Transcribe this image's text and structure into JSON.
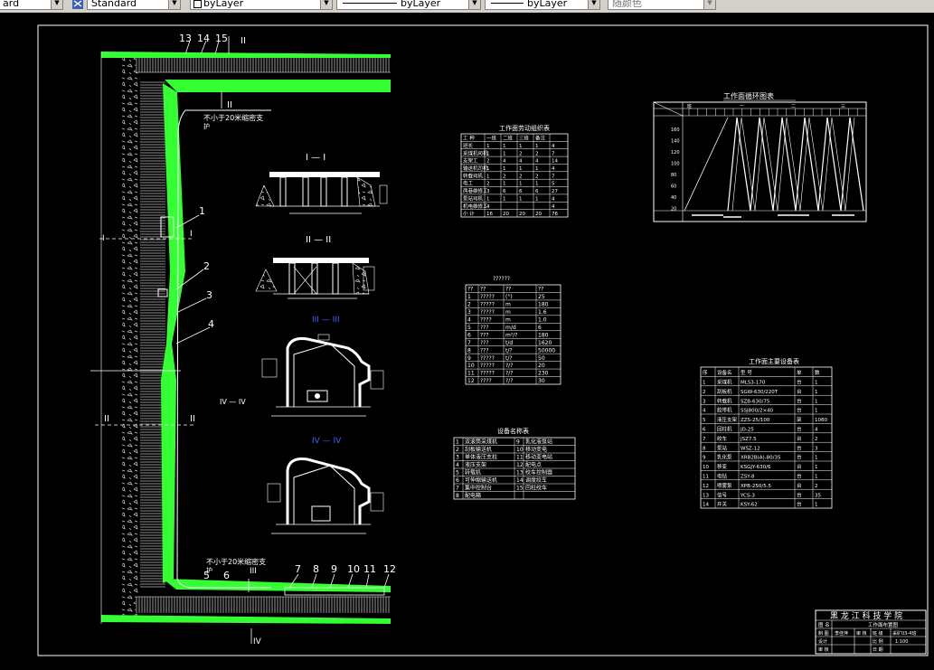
{
  "toolbar": {
    "text_style": "ard",
    "dim_style": "Standard",
    "layer": "byLayer",
    "linetype": "byLayer",
    "lineweight": "byLayer",
    "plot_style": "随颜色"
  },
  "drawing": {
    "labels": {
      "n13": "13",
      "n14": "14",
      "n15": "15",
      "sec2_top": "II",
      "sec2_mid": "II",
      "min20_top": "不小于20米缩密支",
      "min20_top2": "护",
      "n1": "1",
      "n2": "2",
      "n3": "3",
      "n4": "4",
      "sec1_left": "I",
      "sec1_right": "I",
      "sec2_left": "II",
      "sec2_right": "II",
      "min20_bot": "不小于20米缩密支",
      "min20_bot2": "护",
      "n5": "5",
      "n6": "6",
      "n7": "7",
      "n8": "8",
      "n9": "9",
      "n10": "10",
      "n11": "11",
      "n12": "12",
      "sec3": "III",
      "sec4": "IV",
      "secI_title": "I — I",
      "secII_title": "II — II",
      "secIII_title": "III — III",
      "secIV_title": "IV — IV",
      "secIII_blue": "III — III",
      "secIV_blue": "IV — IV"
    },
    "table_workers": {
      "title": "工作面劳动组织表",
      "headers": [
        "工 种",
        "一班",
        "二班",
        "三班",
        "备注"
      ],
      "rows": [
        [
          "班长",
          "1",
          "1",
          "1",
          "1",
          "4"
        ],
        [
          "采煤机司机",
          "1",
          "1",
          "2",
          "2",
          "7"
        ],
        [
          "支架工",
          "2",
          "4",
          "4",
          "4",
          "14"
        ],
        [
          "输送机司机",
          "1",
          "1",
          "1",
          "1",
          "4"
        ],
        [
          "转载司机",
          "1",
          "2",
          "2",
          "2",
          "7"
        ],
        [
          "电工",
          "2",
          "1",
          "1",
          "1",
          "5"
        ],
        [
          "两巷维修工",
          "3",
          "6",
          "6",
          "6",
          "27"
        ],
        [
          "泵站司机",
          "1",
          "1",
          "1",
          "1",
          "4"
        ],
        [
          "机电维修工",
          "4",
          "",
          "",
          "",
          "4"
        ],
        [
          "小 计",
          "16",
          "20",
          "20",
          "20",
          "76"
        ]
      ]
    },
    "table_params": {
      "title": "??????",
      "headers": [
        "??",
        "??",
        "??",
        "??"
      ],
      "rows": [
        [
          "1",
          "?????",
          "(°)",
          "25"
        ],
        [
          "2",
          "?????",
          "m",
          "180"
        ],
        [
          "3",
          "?????",
          "m",
          "1.6"
        ],
        [
          "4",
          "????",
          "m",
          "1.0"
        ],
        [
          "5",
          "???",
          "m/d",
          "6"
        ],
        [
          "6",
          "???",
          "m²/?",
          "180"
        ],
        [
          "7",
          "???",
          "t/d",
          "1620"
        ],
        [
          "8",
          "???",
          "t/?",
          "50000"
        ],
        [
          "9",
          "?????",
          "t/?",
          "50"
        ],
        [
          "10",
          "?????",
          "?/?",
          "20"
        ],
        [
          "11",
          "?????",
          "?/?",
          "230"
        ],
        [
          "12",
          "????",
          "?/?",
          "30"
        ]
      ]
    },
    "table_legend": {
      "title": "设备名称表",
      "rows": [
        [
          "1",
          "双滚筒采煤机",
          "9",
          "乳化液泵站"
        ],
        [
          "2",
          "刮板输送机",
          "10",
          "移动变电"
        ],
        [
          "3",
          "单体液压支柱",
          "11",
          "移动变电站"
        ],
        [
          "4",
          "液压支架",
          "12",
          "配电点"
        ],
        [
          "5",
          "转载机",
          "13",
          "绞车控制器"
        ],
        [
          "6",
          "可伸缩输送机",
          "14",
          "调度绞车"
        ],
        [
          "7",
          "集中控制台",
          "15",
          "回柱绞车"
        ],
        [
          "8",
          "配电箱",
          "",
          ""
        ]
      ]
    },
    "table_equipment": {
      "title": "工作面主要设备表",
      "headers": [
        "序",
        "设备名",
        "型 号",
        "单",
        "数"
      ],
      "rows": [
        [
          "1",
          "采煤机",
          "MLS3-170",
          "台",
          "1"
        ],
        [
          "2",
          "刮板机",
          "SGW-630/220T",
          "台",
          "1"
        ],
        [
          "3",
          "转载机",
          "SZB-630/75",
          "台",
          "1"
        ],
        [
          "4",
          "胶带机",
          "SSJ800/2×40",
          "台",
          "1"
        ],
        [
          "5",
          "液压支架",
          "ZZS-25/100",
          "架",
          "1080"
        ],
        [
          "6",
          "回柱机",
          "JD-25",
          "台",
          "4"
        ],
        [
          "7",
          "绞车",
          "JSZ7.5",
          "台",
          "2"
        ],
        [
          "8",
          "泵站",
          "WSZ-12",
          "台",
          "3"
        ],
        [
          "9",
          "乳化泵",
          "XRB2B(A)-80/35",
          "台",
          "1"
        ],
        [
          "10",
          "移变",
          "KSGJY-630/6",
          "台",
          "1"
        ],
        [
          "11",
          "电钻",
          "ZSY-8",
          "台",
          "1"
        ],
        [
          "12",
          "喷雾泵",
          "XPB-250/5.5",
          "台",
          "2"
        ],
        [
          "13",
          "信号",
          "YCS-3",
          "台",
          "35"
        ],
        [
          "14",
          "开关",
          "KSY-62",
          "台",
          "1"
        ]
      ]
    },
    "cycle_chart": {
      "title": "工作面循环图表",
      "header": [
        "班",
        "一",
        "二",
        "三"
      ],
      "y_ticks": [
        "160",
        "140",
        "120",
        "100",
        "80",
        "60",
        "40",
        "20"
      ]
    },
    "title_block": {
      "school": "黑 龙 江 科 技 学 院",
      "drawing_name_label": "图 名",
      "drawing_name": "工作面布置图",
      "draw_label": "制 图",
      "drafter": "李佳萍",
      "check_label": "审 核",
      "class_label": "班 级",
      "class_value": "采矿03-4班",
      "design_label": "设计",
      "scale_label": "比 例",
      "scale_value": "1:100",
      "date_label": "日 期",
      "drawing_no_label": "审 核"
    }
  }
}
